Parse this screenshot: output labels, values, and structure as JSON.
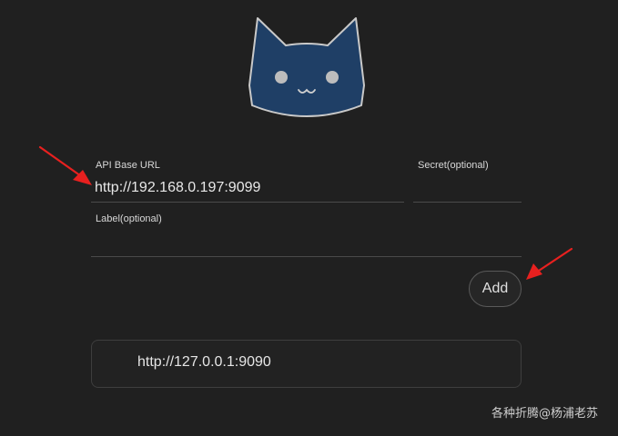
{
  "form": {
    "api_base_url": {
      "label": "API Base URL",
      "value": "http://192.168.0.197:9099"
    },
    "secret": {
      "label": "Secret(optional)",
      "value": ""
    },
    "label_field": {
      "label": "Label(optional)",
      "value": ""
    },
    "add_button": "Add"
  },
  "backends": [
    {
      "url": "http://127.0.0.1:9090"
    }
  ],
  "watermark": "各种折腾@杨浦老苏",
  "colors": {
    "background": "#202020",
    "logo_fill": "#1f3f66",
    "logo_stroke": "#c9c9c9",
    "annotation_arrow": "#e8201f"
  },
  "icons": {
    "logo": "clash-cat-logo",
    "annotation": "red-arrow-annotation"
  }
}
